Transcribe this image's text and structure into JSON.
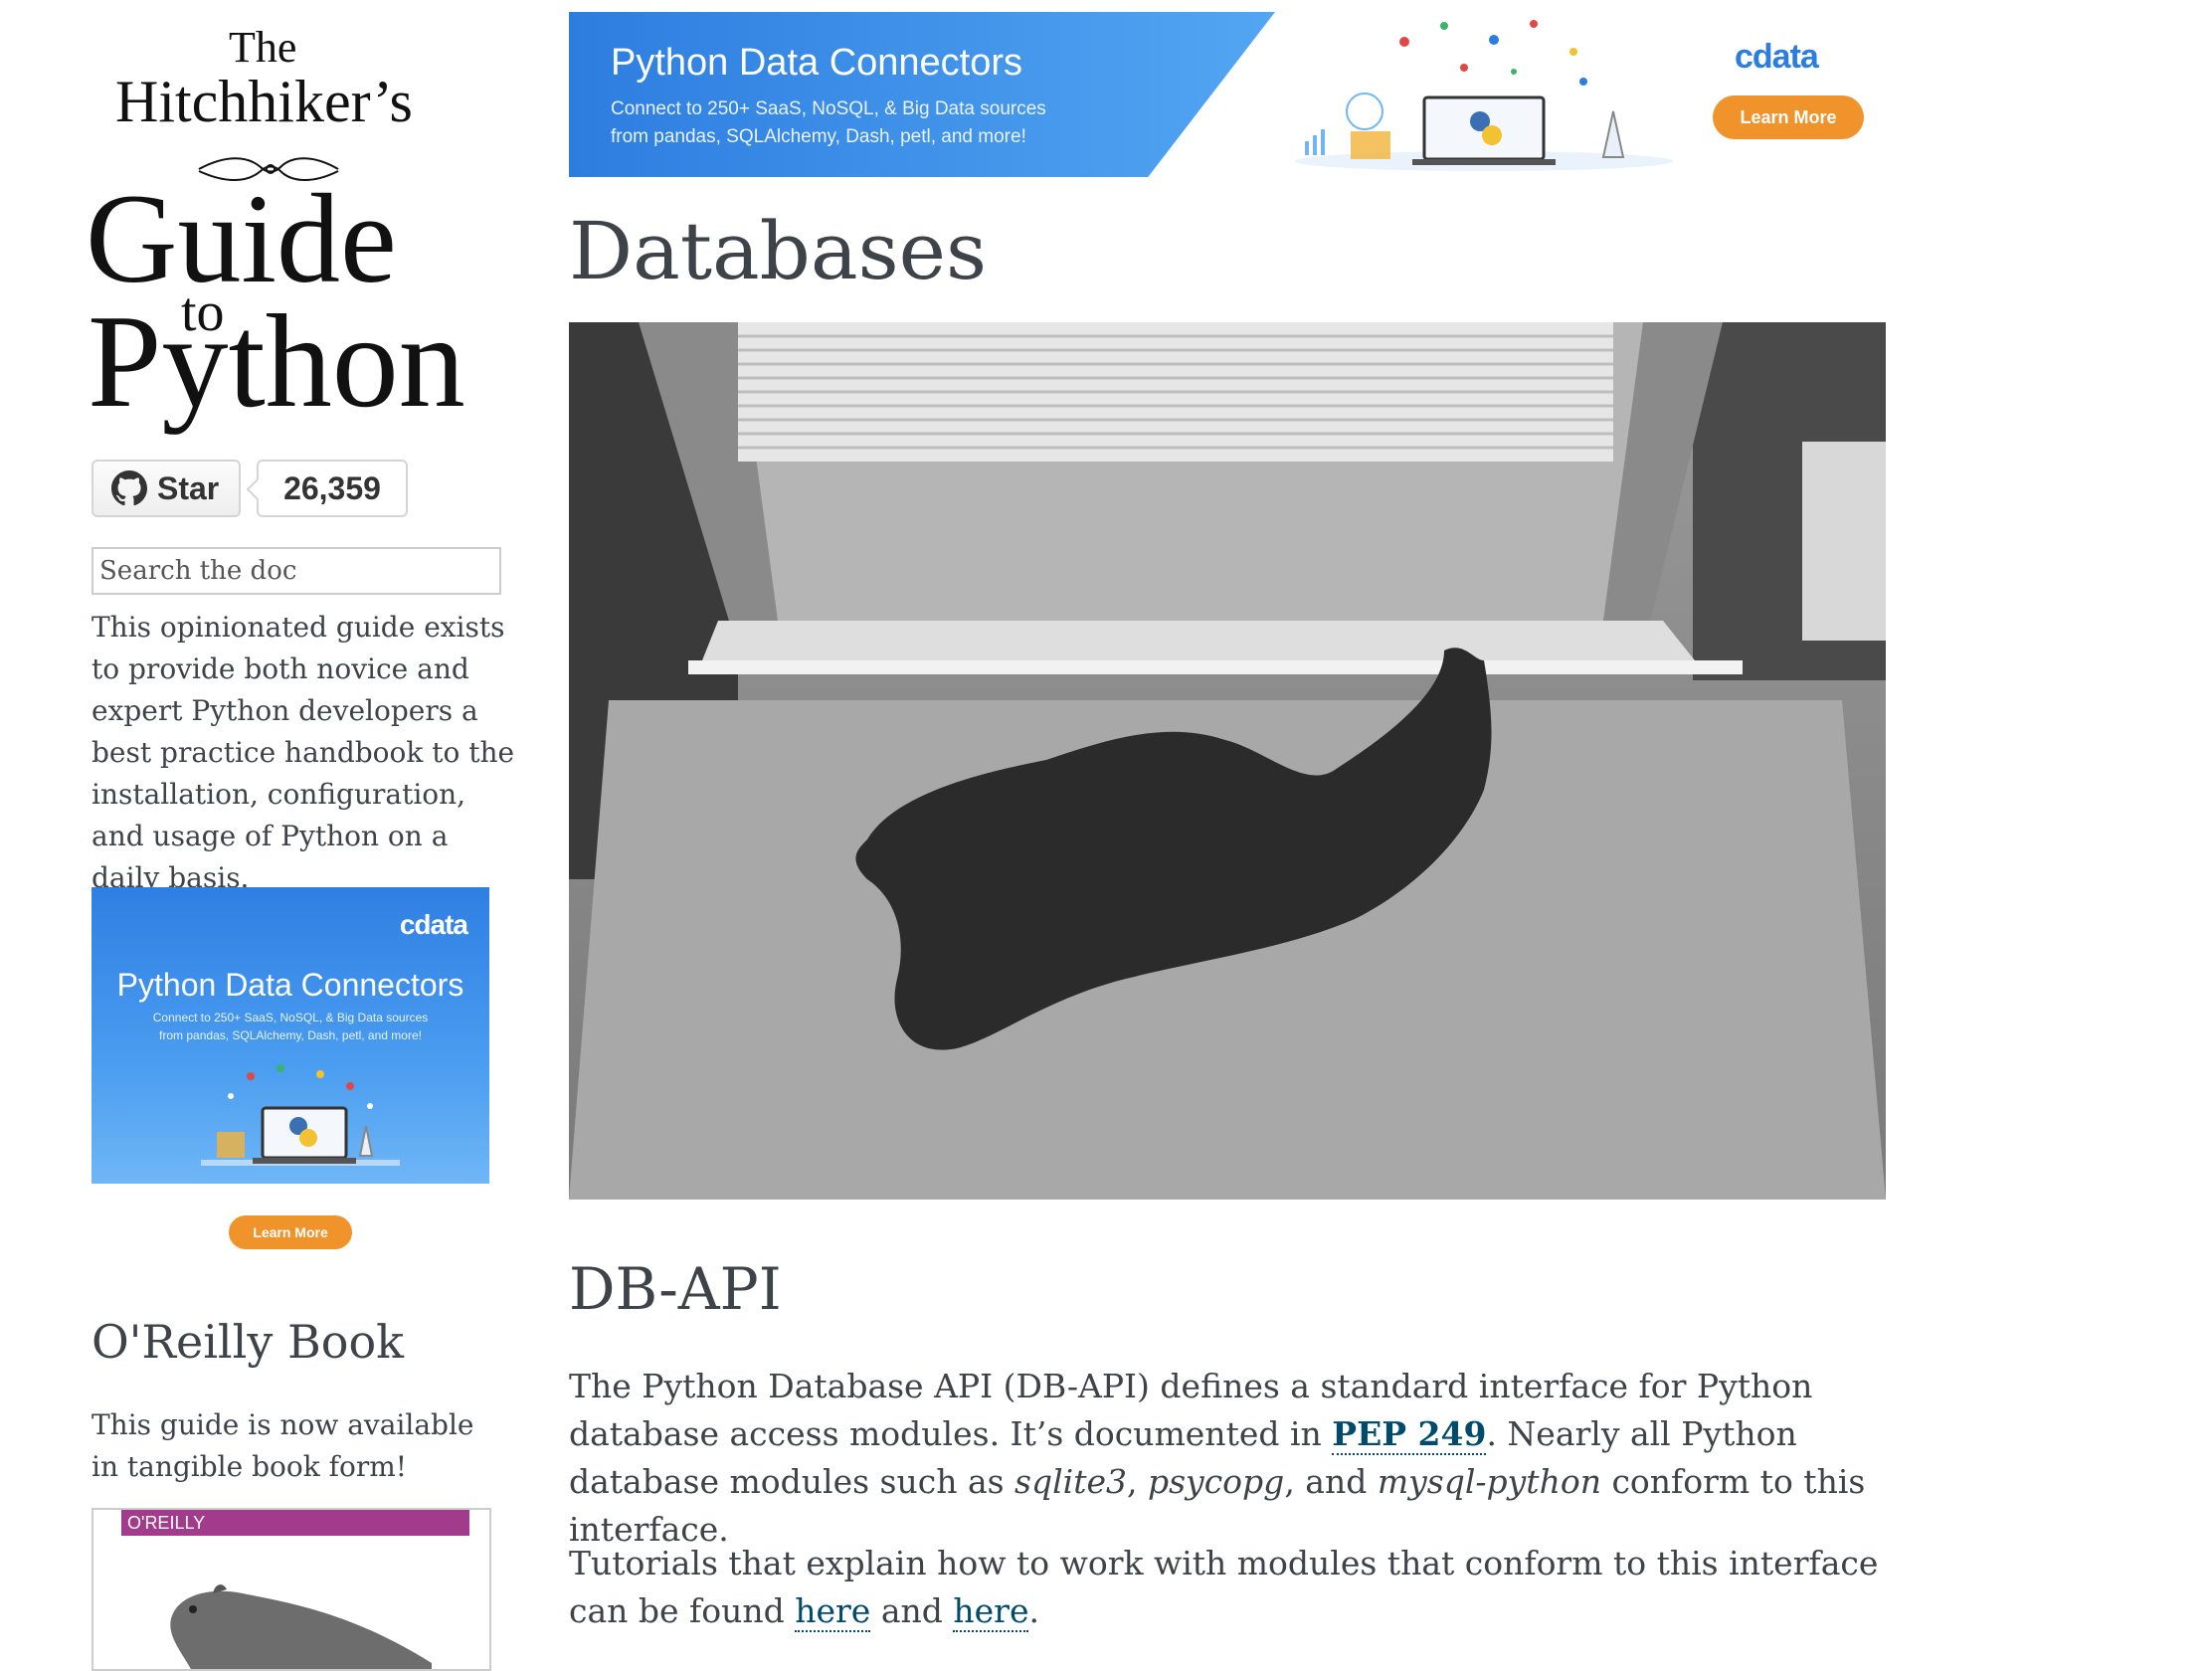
{
  "logo": {
    "the": "The",
    "hitchhikers": "Hitchhiker’s",
    "guide": "Guide",
    "to": "to",
    "python": "Python"
  },
  "github": {
    "star_label": "Star",
    "star_count": "26,359",
    "icon": "github-icon"
  },
  "search": {
    "placeholder": "Search the doc",
    "value": ""
  },
  "sidebar": {
    "intro": "This opinionated guide exists to provide both novice and expert Python developers a best practice handbook to the installation, configuration, and usage of Python on a daily basis.",
    "ad": {
      "brand": "cdata",
      "title": "Python Data Connectors",
      "subtitle_line1": "Connect to 250+ SaaS, NoSQL, & Big Data sources",
      "subtitle_line2": "from pandas, SQLAlchemy, Dash, petl, and more!",
      "button": "Learn More"
    },
    "oreilly_heading": "O'Reilly Book",
    "oreilly_text": "This guide is now available in tangible book form!",
    "book_publisher": "O'REILLY"
  },
  "top_ad": {
    "title": "Python Data Connectors",
    "subtitle_line1": "Connect to 250+ SaaS, NoSQL, & Big Data sources",
    "subtitle_line2": "from pandas, SQLAlchemy, Dash, petl, and more!",
    "brand": "cdata",
    "button": "Learn More"
  },
  "main": {
    "title": "Databases",
    "section_heading": "DB-API",
    "p1_a": "The Python Database API (DB-API) defines a standard interface for Python database access modules. It’s documented in ",
    "p1_link": "PEP 249",
    "p1_b": ". Nearly all Python database modules such as ",
    "p1_em1": "sqlite3",
    "p1_sep1": ", ",
    "p1_em2": "psycopg",
    "p1_sep2": ", and ",
    "p1_em3": "mysql-python",
    "p1_c": " conform to this interface.",
    "p2_a": "Tutorials that explain how to work with modules that conform to this interface can be found ",
    "p2_link1": "here",
    "p2_and": " and ",
    "p2_link2": "here",
    "p2_end": "."
  },
  "colors": {
    "text": "#3e4349",
    "link": "#004b6b",
    "ad_blue": "#2d7de0",
    "ad_orange": "#f0932b"
  }
}
